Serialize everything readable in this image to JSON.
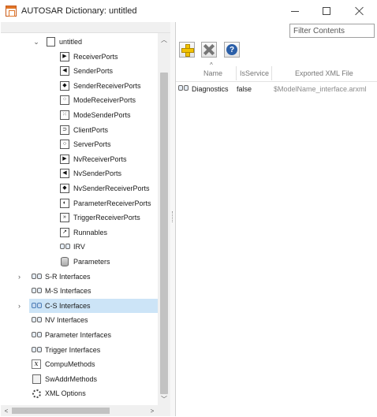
{
  "window": {
    "title": "AUTOSAR Dictionary: untitled"
  },
  "tree": {
    "root_label": "untitled",
    "children": [
      {
        "label": "ReceiverPorts",
        "icon": "receiver-port-icon",
        "glyph": "▶"
      },
      {
        "label": "SenderPorts",
        "icon": "sender-port-icon",
        "glyph": "◀"
      },
      {
        "label": "SenderReceiverPorts",
        "icon": "sender-receiver-port-icon",
        "glyph": "◆"
      },
      {
        "label": "ModeReceiverPorts",
        "icon": "mode-receiver-port-icon",
        "glyph": "⁘"
      },
      {
        "label": "ModeSenderPorts",
        "icon": "mode-sender-port-icon",
        "glyph": "⁙"
      },
      {
        "label": "ClientPorts",
        "icon": "client-port-icon",
        "glyph": "⊃"
      },
      {
        "label": "ServerPorts",
        "icon": "server-port-icon",
        "glyph": "○"
      },
      {
        "label": "NvReceiverPorts",
        "icon": "nv-receiver-port-icon",
        "glyph": "▶"
      },
      {
        "label": "NvSenderPorts",
        "icon": "nv-sender-port-icon",
        "glyph": "◀"
      },
      {
        "label": "NvSenderReceiverPorts",
        "icon": "nv-sender-receiver-port-icon",
        "glyph": "◆"
      },
      {
        "label": "ParameterReceiverPorts",
        "icon": "parameter-receiver-port-icon",
        "glyph": "◐"
      },
      {
        "label": "TriggerReceiverPorts",
        "icon": "trigger-receiver-port-icon",
        "glyph": "»"
      },
      {
        "label": "Runnables",
        "icon": "runnable-icon",
        "glyph": "↗"
      },
      {
        "label": "IRV",
        "icon": "irv-icon",
        "glyph": ""
      },
      {
        "label": "Parameters",
        "icon": "parameters-icon",
        "glyph": ""
      }
    ],
    "top_level": [
      {
        "label": "S-R Interfaces",
        "icon": "interface-icon",
        "expandable": true,
        "selected": false
      },
      {
        "label": "M-S Interfaces",
        "icon": "interface-icon",
        "expandable": false,
        "selected": false
      },
      {
        "label": "C-S Interfaces",
        "icon": "interface-icon",
        "expandable": true,
        "selected": true
      },
      {
        "label": "NV Interfaces",
        "icon": "interface-icon",
        "expandable": false,
        "selected": false
      },
      {
        "label": "Parameter Interfaces",
        "icon": "interface-icon",
        "expandable": false,
        "selected": false
      },
      {
        "label": "Trigger Interfaces",
        "icon": "interface-icon",
        "expandable": false,
        "selected": false
      },
      {
        "label": "CompuMethods",
        "icon": "compu-method-icon",
        "expandable": false,
        "selected": false
      },
      {
        "label": "SwAddrMethods",
        "icon": "swaddr-method-icon",
        "expandable": false,
        "selected": false
      },
      {
        "label": "XML Options",
        "icon": "gear-icon",
        "expandable": false,
        "selected": false
      }
    ]
  },
  "right": {
    "filter_placeholder": "Filter Contents",
    "columns": [
      "Name",
      "IsService",
      "Exported XML File"
    ],
    "rows": [
      {
        "name": "Diagnostics",
        "isservice": "false",
        "xml_file": "$ModelName_interface.arxml"
      }
    ]
  }
}
